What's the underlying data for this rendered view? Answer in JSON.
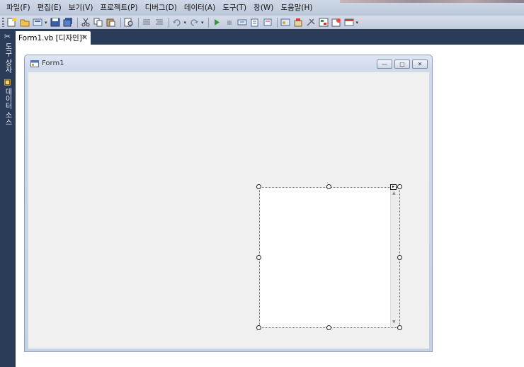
{
  "menu": {
    "items": [
      "파일(F)",
      "편집(E)",
      "보기(V)",
      "프로젝트(P)",
      "디버그(D)",
      "데이터(A)",
      "도구(T)",
      "창(W)",
      "도움말(H)"
    ]
  },
  "toolbar": {
    "icons": [
      "new-project-icon",
      "open-file-icon",
      "add-item-icon",
      "save-icon",
      "save-all-icon",
      "cut-icon",
      "copy-icon",
      "paste-icon",
      "find-icon",
      "comment-icon",
      "uncomment-icon",
      "undo-icon",
      "redo-icon",
      "start-debug-icon",
      "stop-icon",
      "step-into-icon",
      "step-over-icon",
      "step-out-icon",
      "solution-explorer-icon",
      "properties-icon",
      "toolbox-icon",
      "object-browser-icon",
      "start-page-icon",
      "window-icon"
    ]
  },
  "side_panel": {
    "tabs": [
      "도구 상자",
      "데이터 소스"
    ]
  },
  "document_tab": {
    "label": "Form1.vb [디자인]*",
    "close": "×"
  },
  "form": {
    "title": "Form1",
    "caption_buttons": {
      "minimize": "—",
      "maximize": "□",
      "close": "✕"
    }
  },
  "colors": {
    "ide_dark": "#2b3c59",
    "menu_bg": "#cfd8e6",
    "form_client": "#f0f0f0",
    "form_border": "#c6d2e4"
  }
}
